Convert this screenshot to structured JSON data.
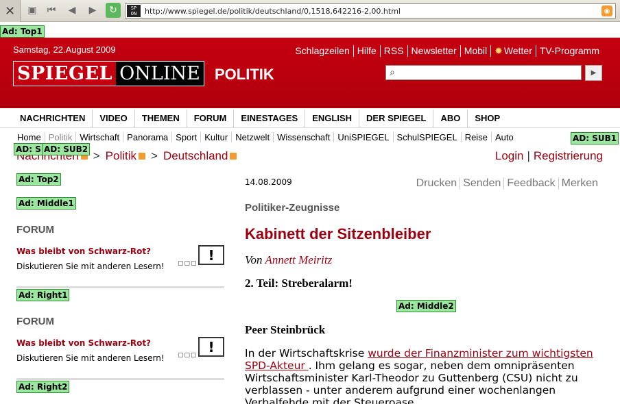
{
  "browser": {
    "url": "http://www.spiegel.de/politik/deutschland/0,1518,642216-2,00.html",
    "site_icon_text_top": "SP",
    "site_icon_text_bottom": "ON"
  },
  "ads": {
    "top1": "Ad: Top1",
    "sub1": "AD: SUB1",
    "sub2": "AD: SUB2",
    "top2": "Ad: Top2",
    "middle1": "Ad: Middle1",
    "right1": "Ad: Right1",
    "right2": "Ad: Right2",
    "middle2": "Ad: Middle2"
  },
  "header": {
    "date": "Samstag, 22.August 2009",
    "toplinks": [
      "Schlagzeilen",
      "Hilfe",
      "RSS",
      "Newsletter",
      "Mobil",
      "Wetter",
      "TV-Programm"
    ],
    "logo_left": "SPIEGEL",
    "logo_right": "ONLINE",
    "section": "POLITIK",
    "search_placeholder": ""
  },
  "nav": {
    "items": [
      "NACHRICHTEN",
      "VIDEO",
      "THEMEN",
      "FORUM",
      "EINESTAGES",
      "ENGLISH",
      "DER SPIEGEL",
      "ABO",
      "SHOP"
    ]
  },
  "subnav": {
    "items": [
      "Home",
      "Politik",
      "Wirtschaft",
      "Panorama",
      "Sport",
      "Kultur",
      "Netzwelt",
      "Wissenschaft",
      "UniSPIEGEL",
      "SchulSPIEGEL",
      "Reise",
      "Auto"
    ]
  },
  "breadcrumb": {
    "items": [
      "Nachrichten",
      "Politik",
      "Deutschland"
    ],
    "separator": ">"
  },
  "account": {
    "login": "Login",
    "divider": "|",
    "register": "Registrierung"
  },
  "forum": [
    {
      "head": "FORUM",
      "question": "Was bleibt von Schwarz-Rot?",
      "discuss": "Diskutieren Sie mit anderen Lesern!",
      "icon": "!"
    },
    {
      "head": "FORUM",
      "question": "Was bleibt von Schwarz-Rot?",
      "discuss": "Diskutieren Sie mit anderen Lesern!",
      "icon": "!"
    }
  ],
  "article": {
    "date": "14.08.2009",
    "tools": [
      "Drucken",
      "Senden",
      "Feedback",
      "Merken"
    ],
    "kicker": "Politiker-Zeugnisse",
    "headline": "Kabinett der Sitzenbleiber",
    "by_prefix": "Von",
    "author": "Annett Meiritz",
    "part": "2. Teil: Streberalarm!",
    "subheading": "Peer Steinbrück",
    "body_1": "In der Wirtschaftskrise ",
    "body_link": "wurde der Finanzminister zum wichtigsten SPD-Akteur ",
    "body_2": ". Ihm gelang es sogar, neben dem omnipräsenten Wirtschaftsminister Karl-Theodor zu Guttenberg (CSU) nicht zu verblassen - unter anderem aufgrund einer wochenlangen Verbalfehde mit der Steueroase"
  }
}
